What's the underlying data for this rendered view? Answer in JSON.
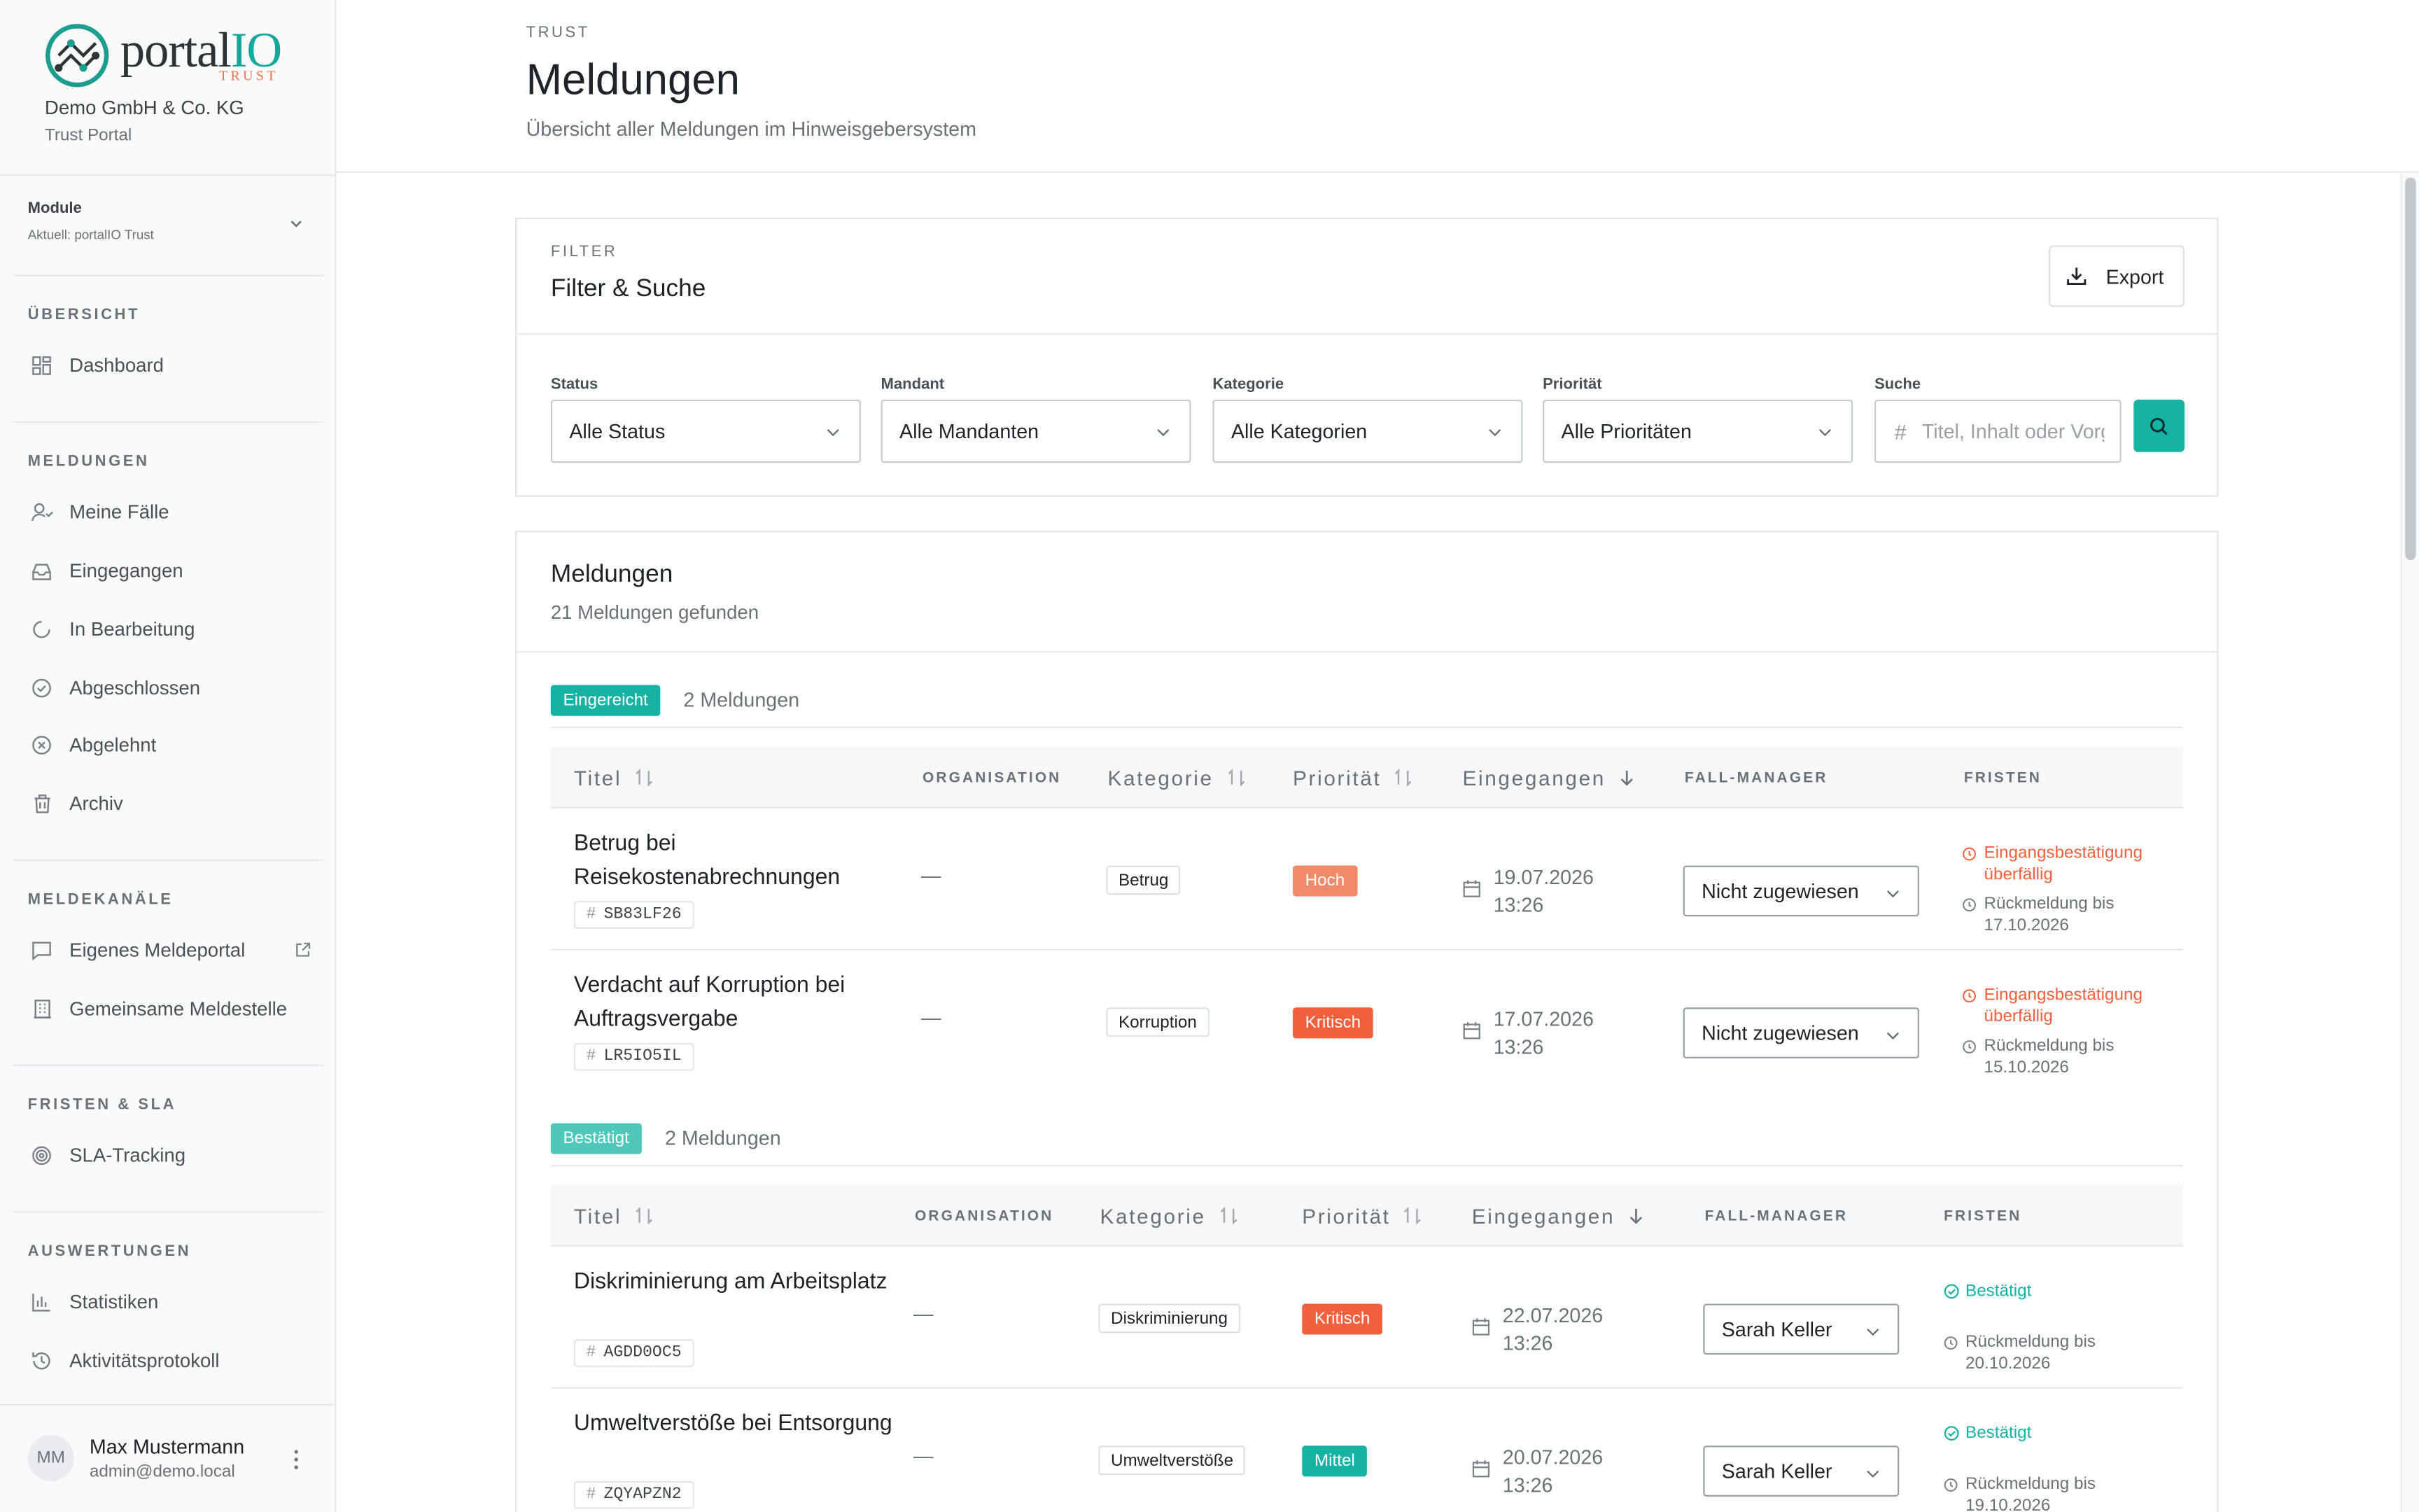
{
  "brand": {
    "logo_main": "portal",
    "logo_accent": "IO",
    "logo_sub": "TRUST",
    "company": "Demo GmbH & Co. KG",
    "company_sub": "Trust Portal",
    "accent_color": "#14b3a4"
  },
  "module": {
    "label": "Module",
    "current": "Aktuell: portalIO Trust"
  },
  "sidebar": {
    "sections": [
      {
        "title": "ÜBERSICHT",
        "items": [
          {
            "label": "Dashboard",
            "icon": "dashboard-icon"
          }
        ]
      },
      {
        "title": "MELDUNGEN",
        "items": [
          {
            "label": "Meine Fälle",
            "icon": "user-check-icon"
          },
          {
            "label": "Eingegangen",
            "icon": "inbox-icon"
          },
          {
            "label": "In Bearbeitung",
            "icon": "progress-icon"
          },
          {
            "label": "Abgeschlossen",
            "icon": "check-circle-icon"
          },
          {
            "label": "Abgelehnt",
            "icon": "x-circle-icon"
          },
          {
            "label": "Archiv",
            "icon": "trash-icon"
          }
        ]
      },
      {
        "title": "MELDEKANÄLE",
        "items": [
          {
            "label": "Eigenes Meldeportal",
            "icon": "message-icon"
          },
          {
            "label": "Gemeinsame Meldestelle",
            "icon": "building-icon"
          }
        ]
      },
      {
        "title": "FRISTEN & SLA",
        "items": [
          {
            "label": "SLA-Tracking",
            "icon": "target-icon"
          }
        ]
      },
      {
        "title": "AUSWERTUNGEN",
        "items": [
          {
            "label": "Statistiken",
            "icon": "bar-chart-icon"
          },
          {
            "label": "Aktivitätsprotokoll",
            "icon": "history-icon"
          }
        ]
      }
    ]
  },
  "user": {
    "initials": "MM",
    "name": "Max Mustermann",
    "email": "admin@demo.local"
  },
  "header": {
    "eyebrow": "TRUST",
    "title": "Meldungen",
    "subtitle": "Übersicht aller Meldungen im Hinweisgebersystem"
  },
  "filter": {
    "eyebrow": "FILTER",
    "title": "Filter & Suche",
    "export_label": "Export",
    "fields": [
      {
        "label": "Status",
        "value": "Alle Status"
      },
      {
        "label": "Mandant",
        "value": "Alle Mandanten"
      },
      {
        "label": "Kategorie",
        "value": "Alle Kategorien"
      },
      {
        "label": "Priorität",
        "value": "Alle Prioritäten"
      }
    ],
    "search_label": "Suche",
    "search_placeholder": "Titel, Inhalt oder Vorgangsnummer"
  },
  "list": {
    "title": "Meldungen",
    "subtitle": "21 Meldungen gefunden",
    "columns": {
      "title": "Titel",
      "organisation": "ORGANISATION",
      "category": "Kategorie",
      "priority": "Priorität",
      "received": "Eingegangen",
      "manager": "FALL-MANAGER",
      "deadlines": "FRISTEN"
    },
    "groups": [
      {
        "status": "Eingereicht",
        "color": "#14b3a4",
        "count": "2 Meldungen",
        "rows": [
          {
            "title": "Betrug bei Reisekostenabrechnungen",
            "id": "SB83LF26",
            "org": "—",
            "category": "Betrug",
            "priority": "Hoch",
            "priority_color": "#f08a68",
            "date": "19.07.2026",
            "time": "13:26",
            "manager": "Nicht zugewiesen",
            "deadline1": "Eingangsbestätigung überfällig",
            "deadline1_color": "#f0603c",
            "deadline2": "Rückmeldung bis 17.10.2026"
          },
          {
            "title": "Verdacht auf Korruption bei Auftragsvergabe",
            "id": "LR5IO5IL",
            "org": "—",
            "category": "Korruption",
            "priority": "Kritisch",
            "priority_color": "#f0603c",
            "date": "17.07.2026",
            "time": "13:26",
            "manager": "Nicht zugewiesen",
            "deadline1": "Eingangsbestätigung überfällig",
            "deadline1_color": "#f0603c",
            "deadline2": "Rückmeldung bis 15.10.2026"
          }
        ]
      },
      {
        "status": "Bestätigt",
        "color": "#4fc7ba",
        "count": "2 Meldungen",
        "rows": [
          {
            "title": "Diskriminierung am Arbeitsplatz",
            "id": "AGDD0OC5",
            "org": "—",
            "category": "Diskriminierung",
            "priority": "Kritisch",
            "priority_color": "#f0603c",
            "date": "22.07.2026",
            "time": "13:26",
            "manager": "Sarah Keller",
            "deadline1": "Bestätigt",
            "deadline1_color": "#14b3a4",
            "deadline2": "Rückmeldung bis 20.10.2026"
          },
          {
            "title": "Umweltverstöße bei Entsorgung",
            "id": "ZQYAPZN2",
            "org": "—",
            "category": "Umweltverstöße",
            "priority": "Mittel",
            "priority_color": "#14b3a4",
            "date": "20.07.2026",
            "time": "13:26",
            "manager": "Sarah Keller",
            "deadline1": "Bestätigt",
            "deadline1_color": "#14b3a4",
            "deadline2": "Rückmeldung bis 19.10.2026"
          }
        ]
      }
    ]
  }
}
